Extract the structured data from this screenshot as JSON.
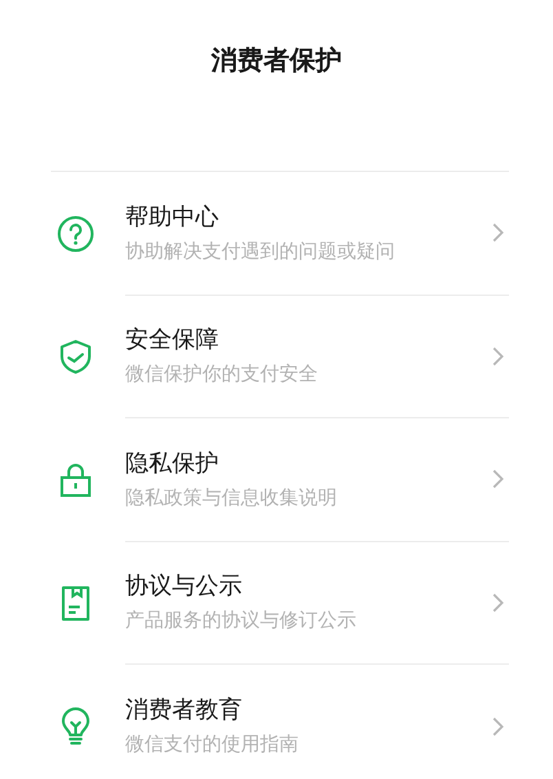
{
  "title": "消费者保护",
  "items": [
    {
      "label": "帮助中心",
      "description": "协助解决支付遇到的问题或疑问"
    },
    {
      "label": "安全保障",
      "description": "微信保护你的支付安全"
    },
    {
      "label": "隐私保护",
      "description": "隐私政策与信息收集说明"
    },
    {
      "label": "协议与公示",
      "description": "产品服务的协议与修订公示"
    },
    {
      "label": "消费者教育",
      "description": "微信支付的使用指南"
    }
  ]
}
